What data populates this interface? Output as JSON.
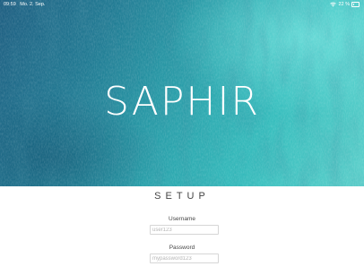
{
  "status_bar": {
    "time": "09:59",
    "date": "Mo. 2. Sep.",
    "battery": "22 %",
    "wifi_icon": "wifi-icon",
    "battery_icon": "battery-icon"
  },
  "hero": {
    "brand": "SAPHIR"
  },
  "setup": {
    "title": "SETUP",
    "username": {
      "label": "Username",
      "placeholder": "user123"
    },
    "password": {
      "label": "Password",
      "placeholder": "mypassword123"
    }
  }
}
